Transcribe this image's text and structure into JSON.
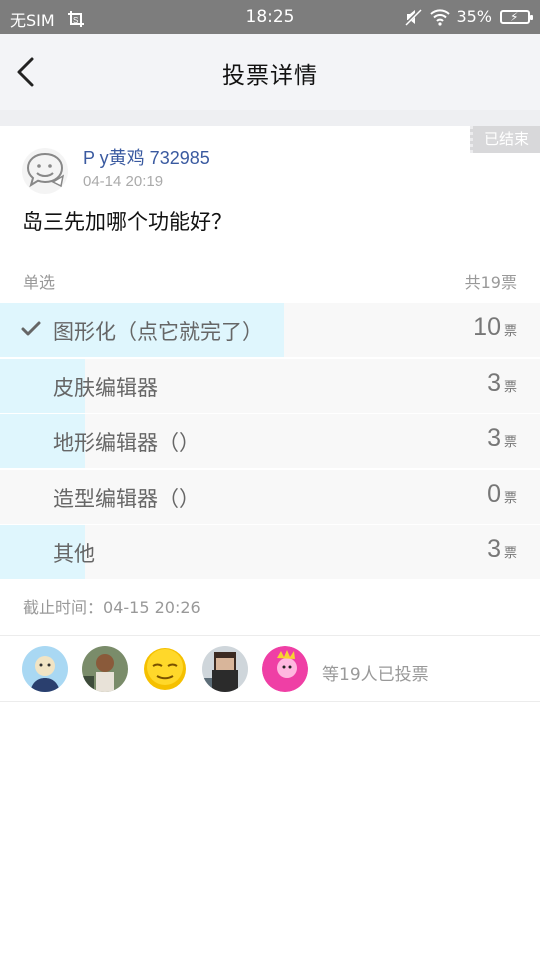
{
  "status_bar": {
    "carrier": "无SIM",
    "time": "18:25",
    "battery": "35%"
  },
  "nav": {
    "title": "投票详情"
  },
  "post": {
    "status_tag": "已结束",
    "author": "P y黄鸡 732985",
    "time": "04-14 20:19",
    "question": "岛三先加哪个功能好？"
  },
  "vote": {
    "type_label": "单选",
    "total_label": "共19票",
    "unit": "票",
    "options": [
      {
        "label": "图形化（点它就完了）",
        "count": "10",
        "fraction": 0.5259,
        "selected": true
      },
      {
        "label": "皮肤编辑器",
        "count": "3",
        "fraction": 0.158,
        "selected": false
      },
      {
        "label": "地形编辑器（）",
        "count": "3",
        "fraction": 0.158,
        "selected": false
      },
      {
        "label": "造型编辑器（）",
        "count": "0",
        "fraction": 0,
        "selected": false
      },
      {
        "label": "其他",
        "count": "3",
        "fraction": 0.158,
        "selected": false
      }
    ],
    "deadline_label": "截止时间：",
    "deadline_value": "04-15 20:26"
  },
  "voters": {
    "summary": "等19人已投票",
    "avatars": [
      "avatar-1",
      "avatar-2",
      "avatar-3",
      "avatar-4",
      "avatar-5"
    ]
  },
  "colors": {
    "accent_fill": "#dff6fd",
    "author_blue": "#3a5aa0",
    "statusbar_gray": "#7d7d7d"
  }
}
